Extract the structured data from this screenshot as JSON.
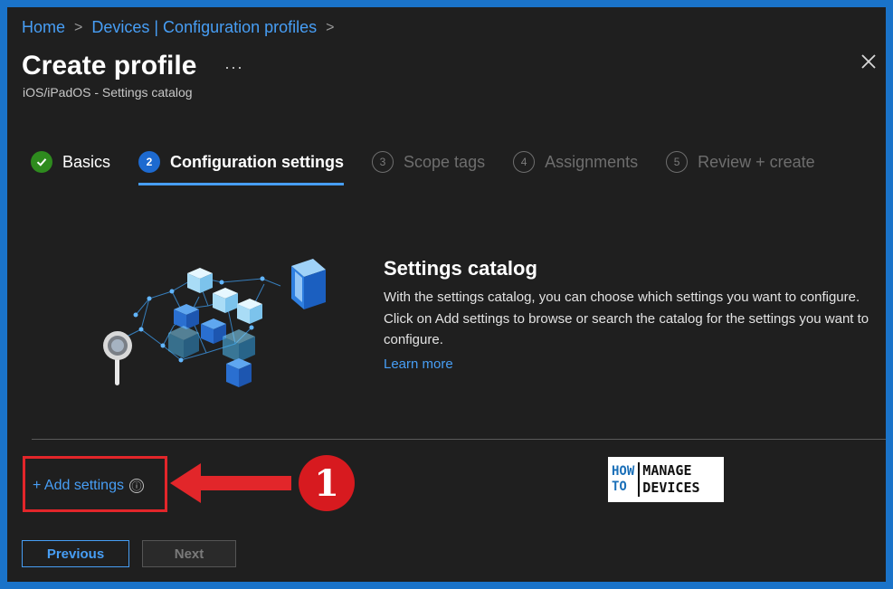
{
  "breadcrumb": {
    "items": [
      "Home",
      "Devices | Configuration profiles"
    ],
    "separator": ">"
  },
  "header": {
    "title": "Create profile",
    "more_label": "···",
    "subtitle": "iOS/iPadOS - Settings catalog",
    "close_icon": "close-icon"
  },
  "steps": [
    {
      "number": "✓",
      "label": "Basics",
      "state": "completed"
    },
    {
      "number": "2",
      "label": "Configuration settings",
      "state": "current"
    },
    {
      "number": "3",
      "label": "Scope tags",
      "state": "upcoming"
    },
    {
      "number": "4",
      "label": "Assignments",
      "state": "upcoming"
    },
    {
      "number": "5",
      "label": "Review + create",
      "state": "upcoming"
    }
  ],
  "hero": {
    "title": "Settings catalog",
    "description": "With the settings catalog, you can choose which settings you want to configure. Click on Add settings to browse or search the catalog for the settings you want to configure.",
    "learn_more": "Learn more",
    "illustration_icon": "settings-catalog-cubes-illustration"
  },
  "add_settings": {
    "label": "+ Add settings",
    "info_icon": "ⓘ"
  },
  "annotation": {
    "callout_number": "1"
  },
  "logo": {
    "line1": "HOW",
    "line2": "TO",
    "line3": "MANAGE",
    "line4": "DEVICES"
  },
  "footer": {
    "previous_label": "Previous",
    "next_label": "Next"
  },
  "colors": {
    "accent": "#479ef5",
    "background": "#1f1f1f",
    "frame_border": "#1a73c9",
    "highlight_red": "#e2262a",
    "success_green": "#2e8b1e"
  }
}
